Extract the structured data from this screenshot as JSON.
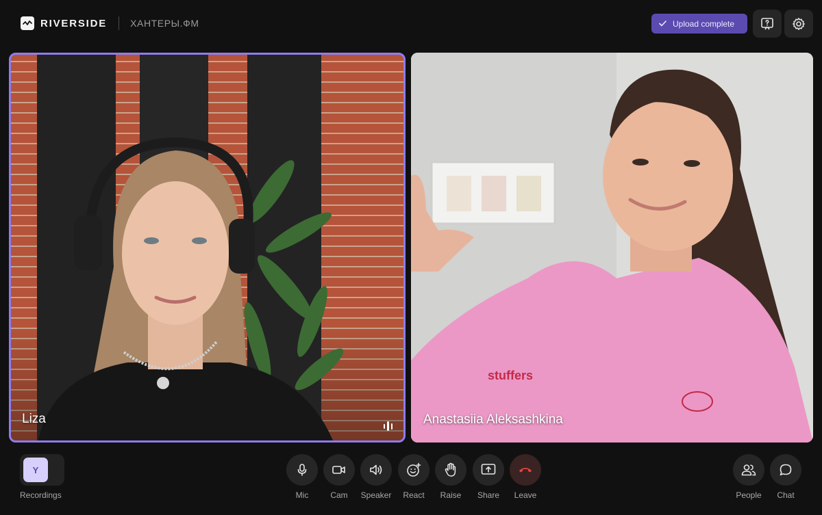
{
  "header": {
    "brand": "RIVERSIDE",
    "studio": "ХАНТЕРЫ.ФМ",
    "upload_status": "Upload complete",
    "help_icon": "help-message-icon",
    "settings_icon": "gear-icon"
  },
  "participants": [
    {
      "name": "Liza",
      "active_speaker": true
    },
    {
      "name": "Anastasiia Aleksashkina",
      "active_speaker": false
    }
  ],
  "toolbar": {
    "recordings": {
      "avatar_letter": "Y",
      "label": "Recordings"
    },
    "controls": [
      {
        "label": "Mic",
        "icon": "microphone-icon"
      },
      {
        "label": "Cam",
        "icon": "camera-icon"
      },
      {
        "label": "Speaker",
        "icon": "speaker-icon"
      },
      {
        "label": "React",
        "icon": "emoji-icon"
      },
      {
        "label": "Raise",
        "icon": "hand-icon"
      },
      {
        "label": "Share",
        "icon": "share-screen-icon"
      },
      {
        "label": "Leave",
        "icon": "phone-hangup-icon"
      }
    ],
    "right": [
      {
        "label": "People",
        "icon": "people-icon"
      },
      {
        "label": "Chat",
        "icon": "chat-icon"
      }
    ]
  },
  "colors": {
    "accent": "#8e7cf0",
    "upload_badge": "#5b4bb0",
    "leave": "#e0463c",
    "background": "#111111"
  }
}
